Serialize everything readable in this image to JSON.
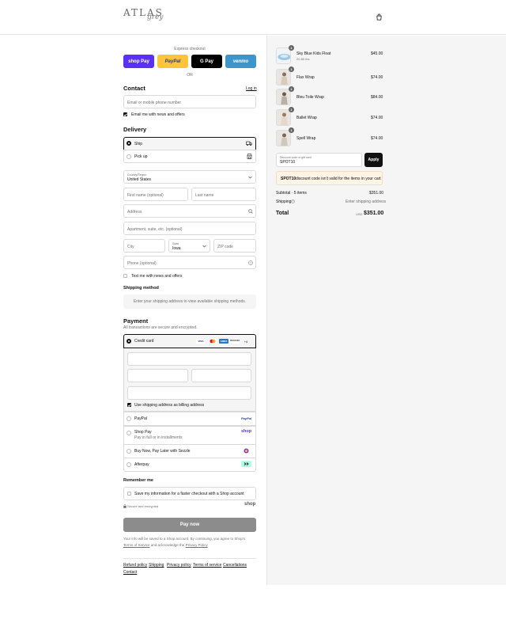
{
  "header": {
    "logo_main": "ATLAS",
    "logo_script": "grey",
    "cart_icon": "bag-icon"
  },
  "express": {
    "label": "Express checkout",
    "buttons": [
      "shop Pay",
      "PayPal",
      "G Pay",
      "venmo"
    ],
    "or": "OR"
  },
  "contact": {
    "title": "Contact",
    "login": "Log in",
    "email_placeholder": "Email or mobile phone number",
    "news_label": "Email me with news and offers"
  },
  "delivery": {
    "title": "Delivery",
    "ship": "Ship",
    "pickup": "Pick up",
    "country_label": "Country/Region",
    "country_value": "United States",
    "first_name": "First name (optional)",
    "last_name": "Last name",
    "address": "Address",
    "apartment": "Apartment, suite, etc. (optional)",
    "city": "City",
    "state_label": "State",
    "state_value": "Iowa",
    "zip": "ZIP code",
    "phone": "Phone (optional)",
    "text_news": "Text me with news and offers"
  },
  "shipping_method": {
    "title": "Shipping method",
    "message": "Enter your shipping address to view available shipping methods."
  },
  "payment": {
    "title": "Payment",
    "subtitle": "All transactions are secure and encrypted.",
    "credit_card": "Credit card",
    "card_logos": [
      "VISA",
      "MC",
      "AMEX",
      "DISCOVER",
      "+4"
    ],
    "billing_same": "Use shipping address as billing address",
    "options": [
      {
        "label": "PayPal",
        "sub": "",
        "logo": "PayPal"
      },
      {
        "label": "Shop Pay",
        "sub": "Pay in full or in installments",
        "logo": "shop"
      },
      {
        "label": "Buy Now, Pay Later with Sezzle",
        "sub": "",
        "logo": ""
      },
      {
        "label": "Afterpay",
        "sub": "",
        "logo": ""
      }
    ]
  },
  "remember": {
    "title": "Remember me",
    "save_label": "Save my information for a faster checkout with a Shop account",
    "secure": "Secure and encrypted",
    "shop": "shop"
  },
  "pay_now": "Pay now",
  "legal": {
    "line1": "Your info will be saved to a Shop account. By continuing, you agree to Shop's",
    "tos": "Terms of Service",
    "and": "and acknowledge the",
    "privacy": "Privacy Policy"
  },
  "footer_links": [
    "Refund policy",
    "Shipping",
    "Privacy policy",
    "Terms of service",
    "Cancellations",
    "Contact"
  ],
  "cart": {
    "items": [
      {
        "name": "Sky Blue Kids Float",
        "variant": "20-50 lbs",
        "price": "$45.00",
        "qty": "1"
      },
      {
        "name": "Flax Wrap",
        "variant": "",
        "price": "$74.00",
        "qty": "1"
      },
      {
        "name": "Bleu Toile Wrap",
        "variant": "",
        "price": "$84.00",
        "qty": "1"
      },
      {
        "name": "Ballet Wrap",
        "variant": "",
        "price": "$74.00",
        "qty": "1"
      },
      {
        "name": "Spell Wrap",
        "variant": "",
        "price": "$74.00",
        "qty": "1"
      }
    ],
    "discount_label": "Discount code or gift card",
    "discount_value": "SPOT10",
    "apply": "Apply",
    "alert_code": "SPOT10",
    "alert_text": "discount code isn't valid for the items in your cart",
    "subtotal_label": "Subtotal · 5 items",
    "subtotal_value": "$351.00",
    "shipping_label": "Shipping",
    "shipping_value": "Enter shipping address",
    "total_label": "Total",
    "currency": "USD",
    "total_value": "$351.00"
  }
}
